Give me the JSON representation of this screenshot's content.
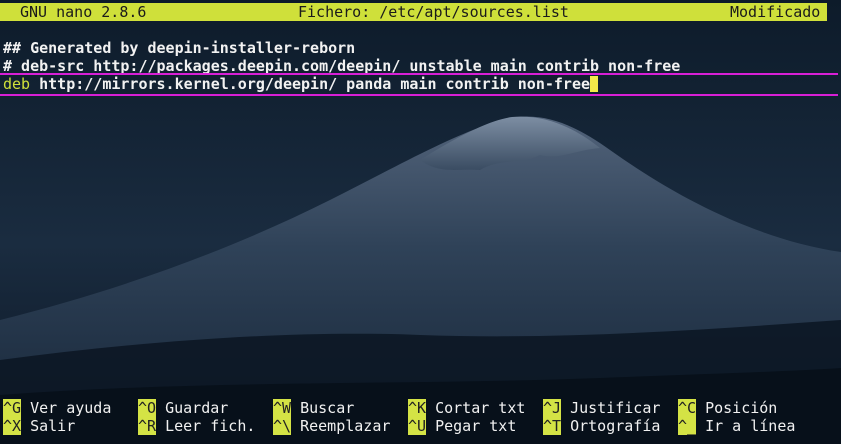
{
  "app": {
    "name": "GNU nano 2.8.6",
    "file": "Fichero: /etc/apt/sources.list",
    "status": "Modificado"
  },
  "editor": {
    "lines": [
      {
        "text": "## Generated by deepin-installer-reborn"
      },
      {
        "text": "# deb-src http://packages.deepin.com/deepin/ unstable main contrib non-free"
      },
      {
        "prefix": "deb",
        "text": " http://mirrors.kernel.org/deepin/ panda main contrib non-free"
      }
    ]
  },
  "shortcuts": {
    "row1": [
      {
        "key": "^G",
        "label": "Ver ayuda"
      },
      {
        "key": "^O",
        "label": "Guardar"
      },
      {
        "key": "^W",
        "label": "Buscar"
      },
      {
        "key": "^K",
        "label": "Cortar txt"
      },
      {
        "key": "^J",
        "label": "Justificar"
      },
      {
        "key": "^C",
        "label": "Posición"
      }
    ],
    "row2": [
      {
        "key": "^X",
        "label": "Salir"
      },
      {
        "key": "^R",
        "label": "Leer fich."
      },
      {
        "key": "^\\",
        "label": "Reemplazar"
      },
      {
        "key": "^U",
        "label": "Pegar txt"
      },
      {
        "key": "^T",
        "label": "Ortografía"
      },
      {
        "key": "^_",
        "label": "Ir a línea"
      }
    ]
  },
  "colors": {
    "titlebar_bg": "#cfe03a",
    "highlight_line": "#d81fd6",
    "key_bg": "#d4e345",
    "cursor": "#f3ea49"
  }
}
